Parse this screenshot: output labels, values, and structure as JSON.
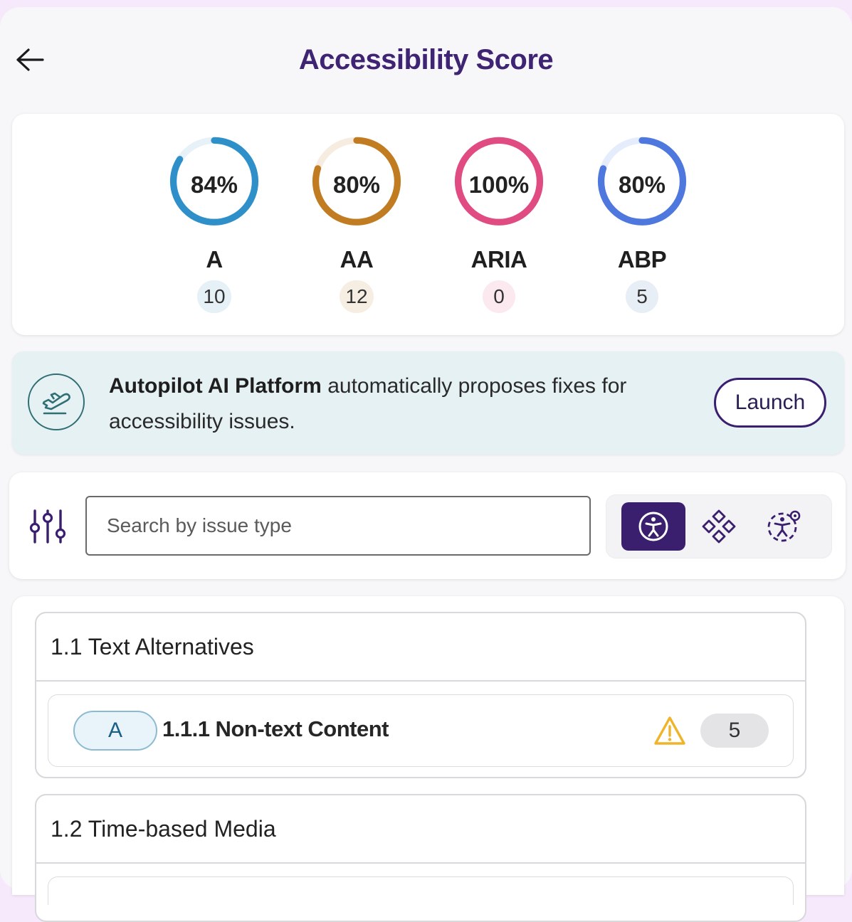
{
  "header": {
    "title": "Accessibility Score"
  },
  "scores": [
    {
      "label": "A",
      "percent_text": "84%",
      "percent": 84,
      "count": "10",
      "color": "#2f90c9",
      "track": "#e6f1f8",
      "pill_bg": "#e5f0f7"
    },
    {
      "label": "AA",
      "percent_text": "80%",
      "percent": 80,
      "count": "12",
      "color": "#c17c22",
      "track": "#f6ece0",
      "pill_bg": "#f7eee3"
    },
    {
      "label": "ARIA",
      "percent_text": "100%",
      "percent": 100,
      "count": "0",
      "color": "#e04b82",
      "track": "#f9e3ec",
      "pill_bg": "#fbe9ef"
    },
    {
      "label": "ABP",
      "percent_text": "80%",
      "percent": 80,
      "count": "5",
      "color": "#4e78dd",
      "track": "#e5ecfb",
      "pill_bg": "#e8eef5"
    }
  ],
  "autopilot": {
    "brand": "Autopilot AI Platform",
    "message": " automatically proposes fixes for accessibility issues.",
    "launch_label": "Launch"
  },
  "search": {
    "placeholder": "Search by issue type"
  },
  "groups": [
    {
      "title": "1.1 Text Alternatives",
      "items": [
        {
          "level": "A",
          "title": "1.1.1 Non-text Content",
          "count": "5"
        }
      ]
    },
    {
      "title": "1.2 Time-based Media"
    }
  ],
  "colors": {
    "accent": "#3a1f6f",
    "title": "#3f2474",
    "warning": "#f0b429"
  }
}
